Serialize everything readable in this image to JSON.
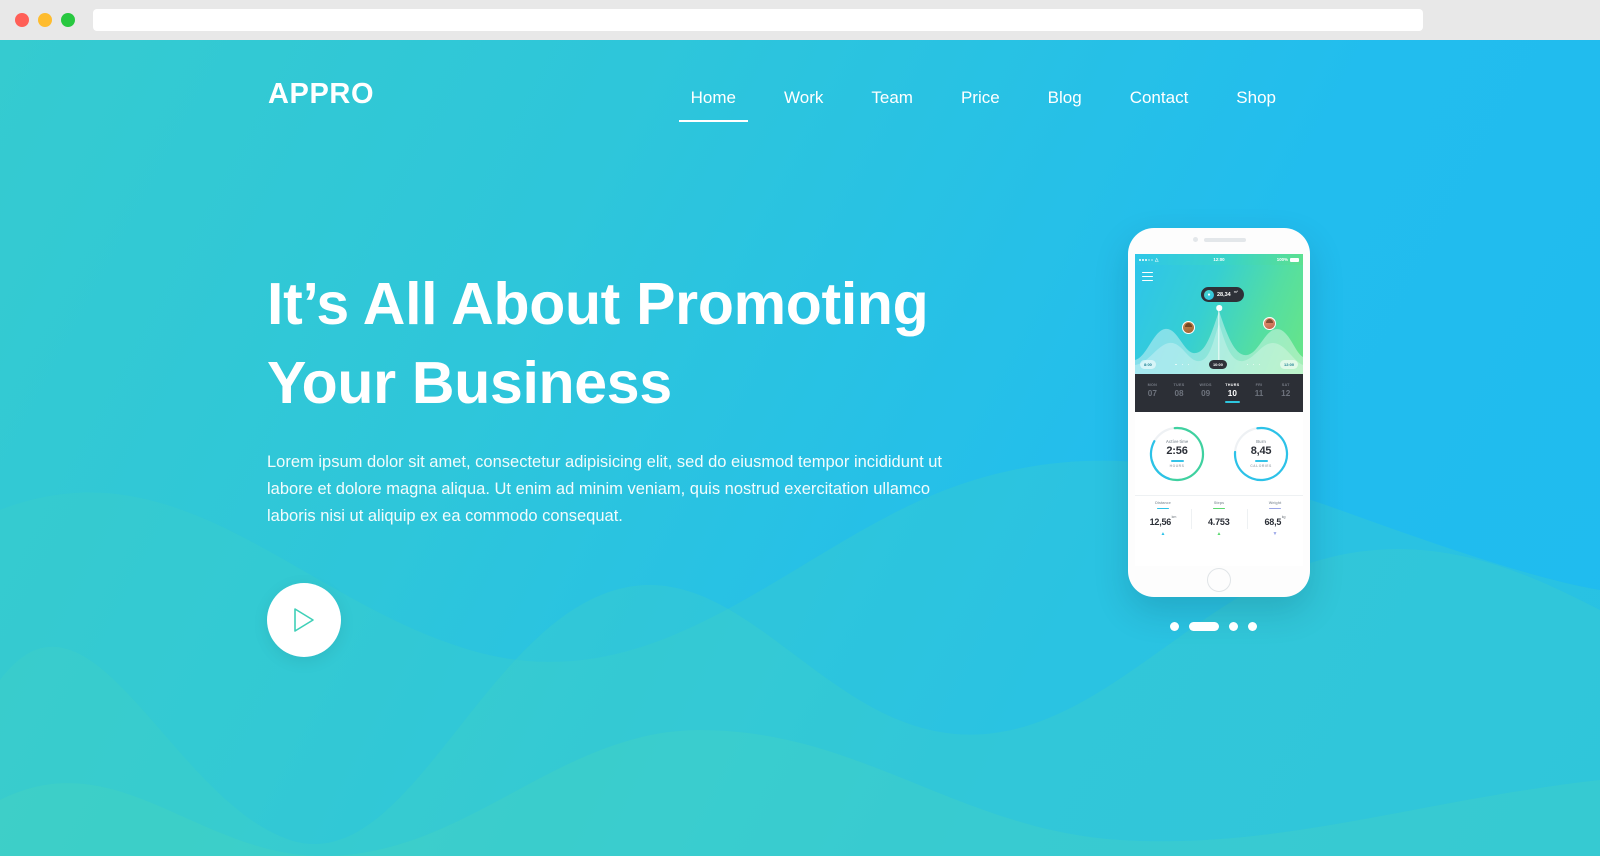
{
  "browser": {
    "traffic_lights": [
      "close",
      "minimize",
      "maximize"
    ],
    "url_value": "",
    "url_placeholder": ""
  },
  "header": {
    "logo": "APPRO",
    "nav": [
      {
        "label": "Home",
        "active": true
      },
      {
        "label": "Work",
        "active": false
      },
      {
        "label": "Team",
        "active": false
      },
      {
        "label": "Price",
        "active": false
      },
      {
        "label": "Blog",
        "active": false
      },
      {
        "label": "Contact",
        "active": false
      },
      {
        "label": "Shop",
        "active": false
      }
    ]
  },
  "hero": {
    "headline_line1": "It’s All About Promoting",
    "headline_line2": "Your Business",
    "subtext": "Lorem ipsum dolor sit amet, consectetur adipisicing elit, sed do eiusmod tempor incididunt ut labore et dolore magna aliqua. Ut enim ad minim veniam, quis nostrud exercitation ullamco laboris nisi ut aliquip ex ea commodo consequat.",
    "play_button_icon": "play-icon"
  },
  "phone": {
    "status_bar": {
      "time": "12:00",
      "battery": "100%"
    },
    "menu_icon": "hamburger-icon",
    "tooltip": {
      "icon": "speed-icon",
      "value": "28,34",
      "unit": "m²"
    },
    "time_pills": [
      {
        "label": "8:00",
        "active": false
      },
      {
        "label": "10:00",
        "active": true
      },
      {
        "label": "12:00",
        "active": false
      }
    ],
    "days": [
      {
        "name": "MON",
        "num": "07",
        "active": false
      },
      {
        "name": "TUES",
        "num": "08",
        "active": false
      },
      {
        "name": "WEDS",
        "num": "09",
        "active": false
      },
      {
        "name": "THURS",
        "num": "10",
        "active": true
      },
      {
        "name": "FRI",
        "num": "11",
        "active": false
      },
      {
        "name": "SAT",
        "num": "12",
        "active": false
      }
    ],
    "gauges": [
      {
        "label": "Active time",
        "value": "2:56",
        "unit": "HOURS",
        "percent": 72,
        "color": "#3fd1a0"
      },
      {
        "label": "Burn",
        "value": "8,45",
        "unit": "CALORIES",
        "percent": 78,
        "color": "#2cc2e8"
      }
    ],
    "stats": [
      {
        "label": "Distance",
        "value": "12,56",
        "unit": "km",
        "trend": "up",
        "color": "#2cc2e8"
      },
      {
        "label": "Steps",
        "value": "4.753",
        "unit": "",
        "trend": "up",
        "color": "#5ad86f"
      },
      {
        "label": "Weight",
        "value": "68,5",
        "unit": "kg",
        "trend": "down",
        "color": "#9aa6e8"
      }
    ]
  },
  "carousel": {
    "slides": [
      {
        "active": false
      },
      {
        "active": true
      },
      {
        "active": false
      },
      {
        "active": false
      }
    ]
  },
  "colors": {
    "gradient_start": "#35cbd0",
    "gradient_end": "#1fbbef",
    "accent_white": "#ffffff",
    "dark_panel": "#2c2f36"
  }
}
